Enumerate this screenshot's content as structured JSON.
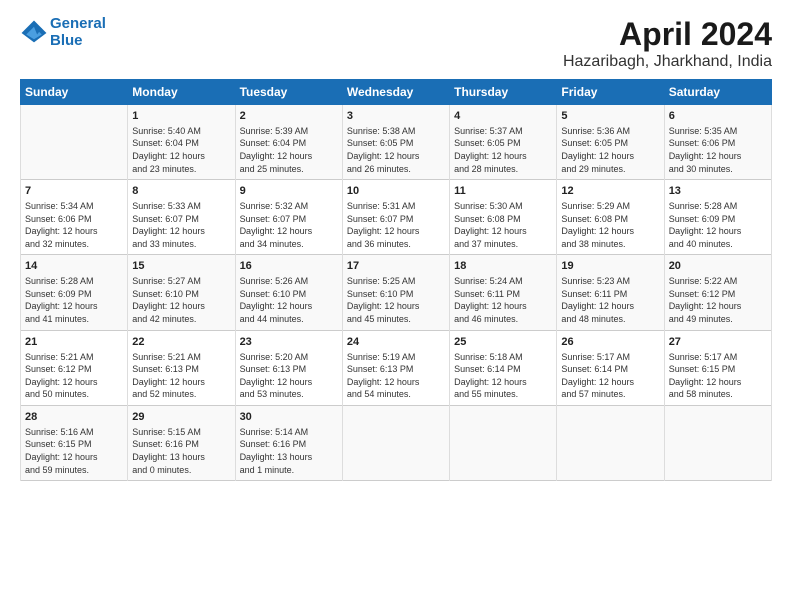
{
  "header": {
    "logo_line1": "General",
    "logo_line2": "Blue",
    "title": "April 2024",
    "subtitle": "Hazaribagh, Jharkhand, India"
  },
  "columns": [
    "Sunday",
    "Monday",
    "Tuesday",
    "Wednesday",
    "Thursday",
    "Friday",
    "Saturday"
  ],
  "weeks": [
    [
      {
        "day": "",
        "content": ""
      },
      {
        "day": "1",
        "content": "Sunrise: 5:40 AM\nSunset: 6:04 PM\nDaylight: 12 hours\nand 23 minutes."
      },
      {
        "day": "2",
        "content": "Sunrise: 5:39 AM\nSunset: 6:04 PM\nDaylight: 12 hours\nand 25 minutes."
      },
      {
        "day": "3",
        "content": "Sunrise: 5:38 AM\nSunset: 6:05 PM\nDaylight: 12 hours\nand 26 minutes."
      },
      {
        "day": "4",
        "content": "Sunrise: 5:37 AM\nSunset: 6:05 PM\nDaylight: 12 hours\nand 28 minutes."
      },
      {
        "day": "5",
        "content": "Sunrise: 5:36 AM\nSunset: 6:05 PM\nDaylight: 12 hours\nand 29 minutes."
      },
      {
        "day": "6",
        "content": "Sunrise: 5:35 AM\nSunset: 6:06 PM\nDaylight: 12 hours\nand 30 minutes."
      }
    ],
    [
      {
        "day": "7",
        "content": "Sunrise: 5:34 AM\nSunset: 6:06 PM\nDaylight: 12 hours\nand 32 minutes."
      },
      {
        "day": "8",
        "content": "Sunrise: 5:33 AM\nSunset: 6:07 PM\nDaylight: 12 hours\nand 33 minutes."
      },
      {
        "day": "9",
        "content": "Sunrise: 5:32 AM\nSunset: 6:07 PM\nDaylight: 12 hours\nand 34 minutes."
      },
      {
        "day": "10",
        "content": "Sunrise: 5:31 AM\nSunset: 6:07 PM\nDaylight: 12 hours\nand 36 minutes."
      },
      {
        "day": "11",
        "content": "Sunrise: 5:30 AM\nSunset: 6:08 PM\nDaylight: 12 hours\nand 37 minutes."
      },
      {
        "day": "12",
        "content": "Sunrise: 5:29 AM\nSunset: 6:08 PM\nDaylight: 12 hours\nand 38 minutes."
      },
      {
        "day": "13",
        "content": "Sunrise: 5:28 AM\nSunset: 6:09 PM\nDaylight: 12 hours\nand 40 minutes."
      }
    ],
    [
      {
        "day": "14",
        "content": "Sunrise: 5:28 AM\nSunset: 6:09 PM\nDaylight: 12 hours\nand 41 minutes."
      },
      {
        "day": "15",
        "content": "Sunrise: 5:27 AM\nSunset: 6:10 PM\nDaylight: 12 hours\nand 42 minutes."
      },
      {
        "day": "16",
        "content": "Sunrise: 5:26 AM\nSunset: 6:10 PM\nDaylight: 12 hours\nand 44 minutes."
      },
      {
        "day": "17",
        "content": "Sunrise: 5:25 AM\nSunset: 6:10 PM\nDaylight: 12 hours\nand 45 minutes."
      },
      {
        "day": "18",
        "content": "Sunrise: 5:24 AM\nSunset: 6:11 PM\nDaylight: 12 hours\nand 46 minutes."
      },
      {
        "day": "19",
        "content": "Sunrise: 5:23 AM\nSunset: 6:11 PM\nDaylight: 12 hours\nand 48 minutes."
      },
      {
        "day": "20",
        "content": "Sunrise: 5:22 AM\nSunset: 6:12 PM\nDaylight: 12 hours\nand 49 minutes."
      }
    ],
    [
      {
        "day": "21",
        "content": "Sunrise: 5:21 AM\nSunset: 6:12 PM\nDaylight: 12 hours\nand 50 minutes."
      },
      {
        "day": "22",
        "content": "Sunrise: 5:21 AM\nSunset: 6:13 PM\nDaylight: 12 hours\nand 52 minutes."
      },
      {
        "day": "23",
        "content": "Sunrise: 5:20 AM\nSunset: 6:13 PM\nDaylight: 12 hours\nand 53 minutes."
      },
      {
        "day": "24",
        "content": "Sunrise: 5:19 AM\nSunset: 6:13 PM\nDaylight: 12 hours\nand 54 minutes."
      },
      {
        "day": "25",
        "content": "Sunrise: 5:18 AM\nSunset: 6:14 PM\nDaylight: 12 hours\nand 55 minutes."
      },
      {
        "day": "26",
        "content": "Sunrise: 5:17 AM\nSunset: 6:14 PM\nDaylight: 12 hours\nand 57 minutes."
      },
      {
        "day": "27",
        "content": "Sunrise: 5:17 AM\nSunset: 6:15 PM\nDaylight: 12 hours\nand 58 minutes."
      }
    ],
    [
      {
        "day": "28",
        "content": "Sunrise: 5:16 AM\nSunset: 6:15 PM\nDaylight: 12 hours\nand 59 minutes."
      },
      {
        "day": "29",
        "content": "Sunrise: 5:15 AM\nSunset: 6:16 PM\nDaylight: 13 hours\nand 0 minutes."
      },
      {
        "day": "30",
        "content": "Sunrise: 5:14 AM\nSunset: 6:16 PM\nDaylight: 13 hours\nand 1 minute."
      },
      {
        "day": "",
        "content": ""
      },
      {
        "day": "",
        "content": ""
      },
      {
        "day": "",
        "content": ""
      },
      {
        "day": "",
        "content": ""
      }
    ]
  ]
}
